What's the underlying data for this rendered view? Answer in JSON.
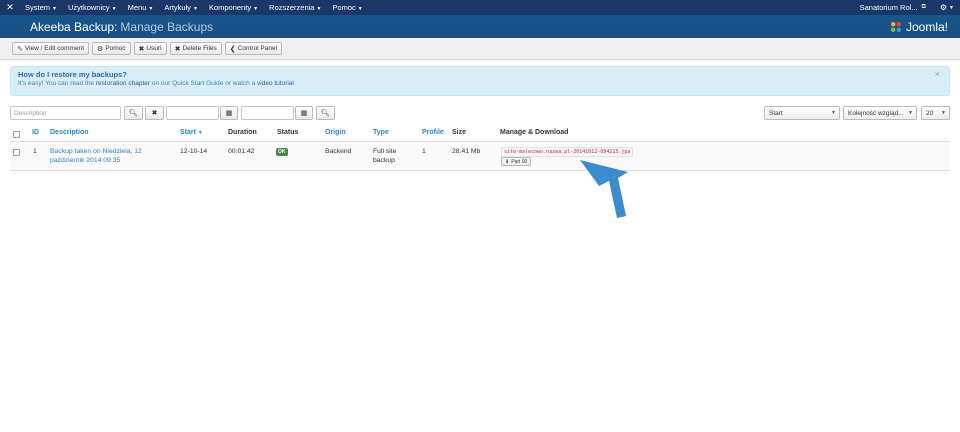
{
  "topbar": {
    "menu": [
      {
        "label": "System"
      },
      {
        "label": "Użytkownicy"
      },
      {
        "label": "Menu"
      },
      {
        "label": "Artykuły"
      },
      {
        "label": "Komponenty"
      },
      {
        "label": "Rozszerzenia"
      },
      {
        "label": "Pomoc"
      }
    ],
    "site_name": "Sanatorium Rol..."
  },
  "header": {
    "title_main": "Akeeba Backup:",
    "title_sub": "Manage Backups",
    "brand": "Joomla!"
  },
  "toolbar": {
    "buttons": [
      {
        "label": "View / Edit comment",
        "icon": "edit-icon"
      },
      {
        "label": "Pomoc",
        "icon": "gear-icon"
      },
      {
        "label": "Usuń",
        "icon": "close-icon"
      },
      {
        "label": "Delete Files",
        "icon": "close-icon"
      },
      {
        "label": "Control Panel",
        "icon": "chevron-left-icon"
      }
    ]
  },
  "info": {
    "heading": "How do I restore my backups?",
    "text_1": "It's easy! You can read the",
    "link_1": "restoration chapter",
    "text_2": "on our Quick Start Guide or watch a",
    "link_2": "video tutorial",
    "close": "×"
  },
  "filters": {
    "description_placeholder": "Description",
    "start_select": "Start",
    "order_select": "Kolejność wzgląd...",
    "limit_select": "20"
  },
  "table": {
    "headers": {
      "id": "ID",
      "description": "Description",
      "start": "Start",
      "duration": "Duration",
      "status": "Status",
      "origin": "Origin",
      "type": "Type",
      "profile": "Profile",
      "size": "Size",
      "manage": "Manage & Download"
    },
    "rows": [
      {
        "id": "1",
        "description_line1": "Backup taken on Niedziela, 12",
        "description_line2": "październik 2014 09:35",
        "start": "12-10-14",
        "duration": "00:01:42",
        "status": "OK",
        "origin": "Backend",
        "type_line1": "Full site",
        "type_line2": "backup",
        "profile": "1",
        "size": "28.41 Mb",
        "filename": "site-malecowo.nazwa.pl-20141012-094215.jpa",
        "part_label": "Part 00"
      }
    ]
  },
  "colors": {
    "topbar": "#1a3867",
    "header": "#17568c",
    "link": "#2a86c9",
    "ok_badge": "#468847",
    "arrow": "#3a8ccf"
  }
}
